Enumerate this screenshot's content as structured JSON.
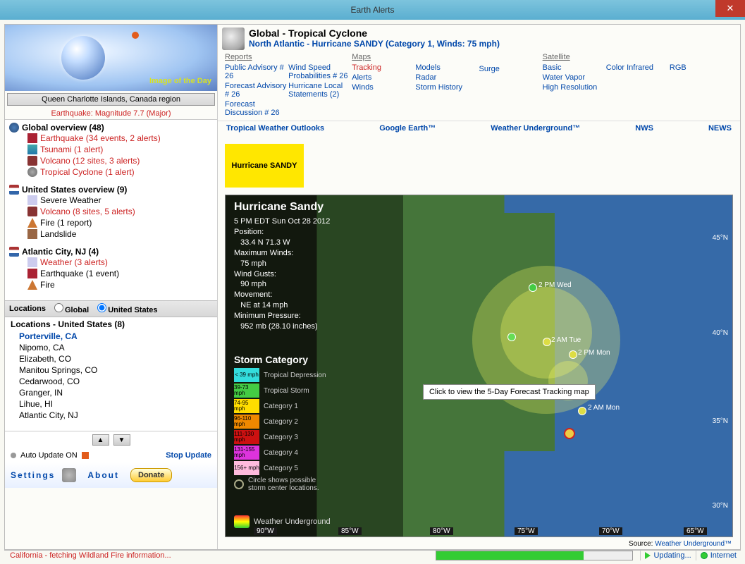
{
  "window": {
    "title": "Earth Alerts",
    "close": "✕"
  },
  "sidebar": {
    "image_of_day": "Image of the Day",
    "region_box": "Queen Charlotte Islands, Canada region",
    "eq_line": "Earthquake: Magnitude 7.7 (Major)",
    "groups": [
      {
        "title": "Global overview (48)",
        "icon": "i-globe",
        "items": [
          {
            "label": "Earthquake (34 events, 2 alerts)",
            "alert": true,
            "icon": "i-eq"
          },
          {
            "label": "Tsunami (1 alert)",
            "alert": true,
            "icon": "i-tsu"
          },
          {
            "label": "Volcano (12 sites, 3 alerts)",
            "alert": true,
            "icon": "i-vol"
          },
          {
            "label": "Tropical Cyclone (1 alert)",
            "alert": true,
            "icon": "i-tc"
          }
        ]
      },
      {
        "title": "United States overview (9)",
        "icon": "i-us",
        "items": [
          {
            "label": "Severe Weather",
            "alert": false,
            "icon": "i-wx"
          },
          {
            "label": "Volcano (8 sites, 5 alerts)",
            "alert": true,
            "icon": "i-vol"
          },
          {
            "label": "Fire (1 report)",
            "alert": false,
            "icon": "i-fire"
          },
          {
            "label": "Landslide",
            "alert": false,
            "icon": "i-land"
          }
        ]
      },
      {
        "title": "Atlantic City, NJ (4)",
        "icon": "i-us",
        "items": [
          {
            "label": "Weather (3 alerts)",
            "alert": true,
            "icon": "i-wx"
          },
          {
            "label": "Earthquake (1 event)",
            "alert": false,
            "icon": "i-eq"
          },
          {
            "label": "Fire",
            "alert": false,
            "icon": "i-fire"
          }
        ]
      }
    ],
    "loc_hdr": "Locations",
    "radio_global": "Global",
    "radio_us": "United States",
    "loc_title": "Locations - United States (8)",
    "locations": [
      "Porterville, CA",
      "Nipomo, CA",
      "Elizabeth, CO",
      "Manitou Springs, CO",
      "Cedarwood, CO",
      "Granger, IN",
      "Lihue, HI",
      "Atlantic City, NJ"
    ],
    "auto": "Auto Update ON",
    "stop": "Stop Update",
    "settings": "Settings",
    "about": "About",
    "donate": "Donate"
  },
  "main": {
    "title": "Global - Tropical Cyclone",
    "subtitle": "North Atlantic - Hurricane SANDY (Category 1, Winds: 75 mph)",
    "cols": [
      {
        "hdr": "Reports",
        "links": [
          {
            "t": "Public Advisory # 26"
          },
          {
            "t": "Forecast Advisory # 26"
          },
          {
            "t": "Forecast Discussion # 26"
          }
        ]
      },
      {
        "hdr": "",
        "links": [
          {
            "t": "Wind Speed Probabilities # 26"
          },
          {
            "t": "Hurricane Local Statements (2)"
          }
        ]
      },
      {
        "hdr": "Maps",
        "links": [
          {
            "t": "Tracking",
            "red": true
          },
          {
            "t": "Alerts"
          },
          {
            "t": "Winds"
          }
        ]
      },
      {
        "hdr": "",
        "links": [
          {
            "t": "Models"
          },
          {
            "t": "Radar"
          },
          {
            "t": "Storm History"
          }
        ]
      },
      {
        "hdr": "",
        "links": [
          {
            "t": ""
          },
          {
            "t": "Surge"
          },
          {
            "t": ""
          }
        ]
      },
      {
        "hdr": "Satellite",
        "links": [
          {
            "t": "Basic"
          },
          {
            "t": "Water Vapor"
          },
          {
            "t": "High Resolution"
          }
        ]
      },
      {
        "hdr": "",
        "links": [
          {
            "t": "Color Infrared"
          },
          {
            "t": ""
          }
        ]
      },
      {
        "hdr": "",
        "links": [
          {
            "t": "RGB"
          },
          {
            "t": ""
          }
        ]
      }
    ],
    "row_links": [
      "Tropical Weather Outlooks",
      "Google Earth™",
      "Weather Underground™",
      "NWS",
      "NEWS"
    ],
    "yellow": "Hurricane SANDY",
    "map": {
      "title": "Hurricane Sandy",
      "info": "5 PM EDT Sun Oct 28 2012\nPosition:\n   33.4 N 71.3 W\nMaximum Winds:\n   75 mph\nWind Gusts:\n   90 mph\nMovement:\n   NE at 14 mph\nMinimum Pressure:\n   952 mb (28.10 inches)",
      "sc_title": "Storm Category",
      "categories": [
        {
          "box": "< 39 mph",
          "color": "#3dd",
          "lbl": "Tropical Depression"
        },
        {
          "box": "39-73 mph",
          "color": "#4c4",
          "lbl": "Tropical Storm"
        },
        {
          "box": "74-95 mph",
          "color": "#fd0",
          "lbl": "Category 1"
        },
        {
          "box": "96-110 mph",
          "color": "#e80",
          "lbl": "Category 2"
        },
        {
          "box": "111-130 mph",
          "color": "#c11",
          "lbl": "Category 3"
        },
        {
          "box": "131-155 mph",
          "color": "#d3d",
          "lbl": "Category 4"
        },
        {
          "box": "156+ mph",
          "color": "#fbd",
          "lbl": "Category 5"
        }
      ],
      "circle_note": "Circle shows possible storm center locations.",
      "wu": "Weather Underground",
      "tooltip": "Click to view the 5-Day Forecast Tracking map",
      "lats": [
        "45°N",
        "40°N",
        "35°N",
        "30°N"
      ],
      "lons": [
        "90°W",
        "85°W",
        "80°W",
        "75°W",
        "70°W",
        "65°W"
      ],
      "dot_labels": [
        "2 PM Wed",
        "",
        "2 AM Tue",
        "2 PM Mon",
        "2 AM Mon",
        ""
      ]
    },
    "source_pre": "Source: ",
    "source": "Weather Underground™"
  },
  "status": {
    "left": "California - fetching Wildland Fire information...",
    "progress": 75,
    "updating": "Updating...",
    "internet": "Internet"
  }
}
